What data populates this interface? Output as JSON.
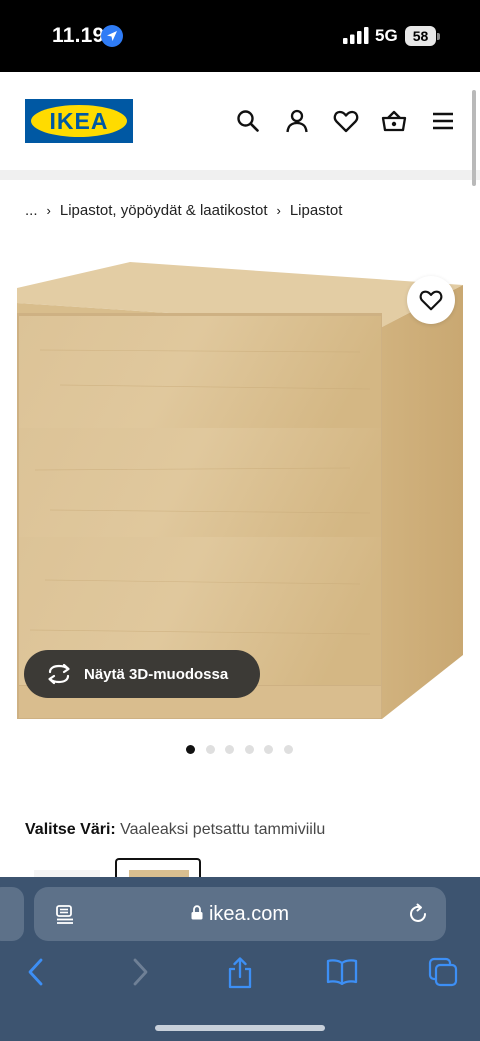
{
  "status_bar": {
    "time": "11.19",
    "network": "5G",
    "battery": "58"
  },
  "header": {
    "logo_text": "IKEA",
    "icons": [
      "search-icon",
      "user-icon",
      "heart-icon",
      "basket-icon",
      "menu-icon"
    ]
  },
  "breadcrumb": {
    "items": [
      "...",
      "Lipastot, yöpöydät & laatikostot",
      "Lipastot"
    ]
  },
  "product": {
    "view_3d_label": "Näytä 3D-muodossa",
    "image_count": 6,
    "active_image": 0
  },
  "color_selector": {
    "label": "Valitse Väri:",
    "value": "Vaaleaksi petsattu tammiviilu"
  },
  "browser": {
    "url": "ikea.com"
  },
  "colors": {
    "ikea_blue": "#0058a3",
    "ikea_yellow": "#ffdb00",
    "browser_bar": "#3d5470",
    "wood": "#d9bf90"
  }
}
